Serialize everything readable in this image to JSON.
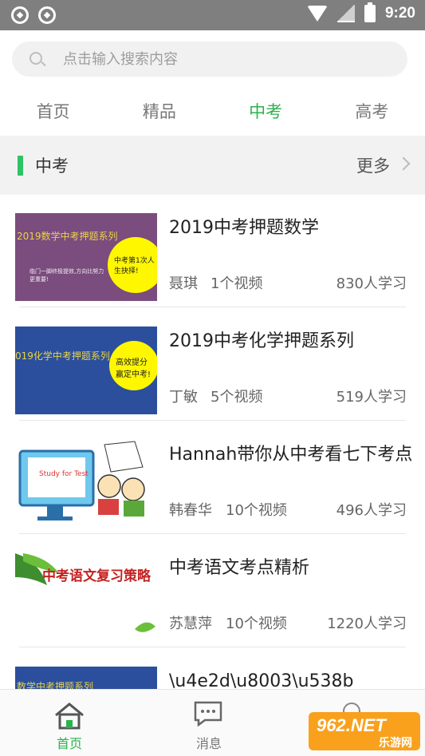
{
  "status_bar": {
    "time": "9:20"
  },
  "search": {
    "placeholder": "点击输入搜索内容"
  },
  "tabs": [
    {
      "label": "首页",
      "active": false
    },
    {
      "label": "精品",
      "active": false
    },
    {
      "label": "中考",
      "active": true
    },
    {
      "label": "高考",
      "active": false
    }
  ],
  "section": {
    "title": "中考",
    "more_label": "更多"
  },
  "courses": [
    {
      "title": "2019中考押题数学",
      "author": "聂琪",
      "videos": "1个视频",
      "learners": "830人学习",
      "thumb": {
        "banner": "2019数学中考押题系列",
        "disc": "中考第1次人生抉择!",
        "note": "临门一脚终极提效,方向比努力更重要!"
      }
    },
    {
      "title": "2019中考化学押题系列",
      "author": "丁敏",
      "videos": "5个视频",
      "learners": "519人学习",
      "thumb": {
        "banner": "019化学中考押题系列",
        "disc": "高效提分赢定中考!"
      }
    },
    {
      "title": "Hannah带你从中考看七下考点",
      "author": "韩春华",
      "videos": "10个视频",
      "learners": "496人学习",
      "thumb": {
        "banner": "Study for Test"
      }
    },
    {
      "title": "中考语文考点精析",
      "author": "苏慧萍",
      "videos": "10个视频",
      "learners": "1220人学习",
      "thumb": {
        "banner": "中考语文复习策略"
      }
    },
    {
      "title": "\\u4e2d\\u8003\\u538b",
      "author": "",
      "videos": "",
      "learners": "",
      "thumb": {
        "banner": "数学中考押题系列"
      }
    }
  ],
  "bottom_nav": [
    {
      "label": "首页",
      "icon": "home-icon",
      "active": true
    },
    {
      "label": "消息",
      "icon": "message-icon",
      "active": false
    },
    {
      "label": "",
      "icon": "profile-icon",
      "active": false
    }
  ],
  "watermark": {
    "top": "962.NET",
    "bottom": "乐游网"
  },
  "colors": {
    "accent": "#2bb24c",
    "section_bar": "#2ec364",
    "status_bar": "#7f7f7f"
  }
}
